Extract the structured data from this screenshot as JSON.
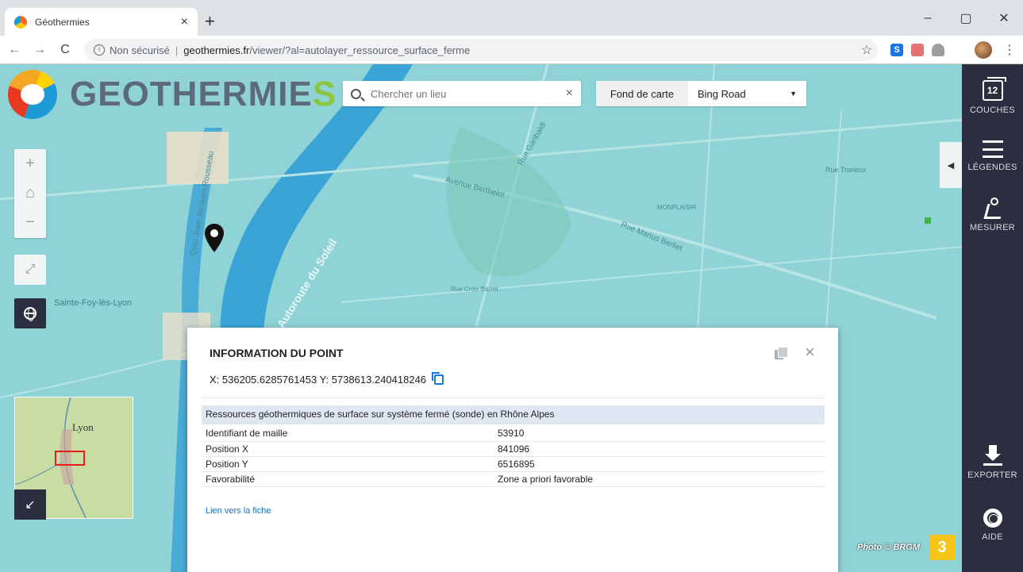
{
  "browser": {
    "tab_title": "Géothermies",
    "tab_close": "×",
    "new_tab": "+",
    "win_minimize": "–",
    "win_maximize": "▢",
    "win_close": "✕",
    "back": "←",
    "forward": "→",
    "reload": "C",
    "info_glyph": "i",
    "security_label": "Non sécurisé",
    "separator": "|",
    "url_domain": "geothermies.fr",
    "url_path": "/viewer/?al=autolayer_ressource_surface_ferme",
    "star": "☆",
    "ext1": "S",
    "menu": "⋮"
  },
  "app": {
    "logo_text_main": "GEOTHERMIE",
    "logo_text_last": "S",
    "search_placeholder": "Chercher un lieu",
    "search_clear": "×",
    "basemap_label": "Fond de carte",
    "basemap_value": "Bing Road",
    "basemap_caret": "▼",
    "zoom_in": "+",
    "home": "⌂",
    "zoom_out": "−",
    "fullscreen": "⤢",
    "overview_collapse": "↙",
    "overview_city": "Lyon",
    "side_collapse": "◀"
  },
  "map_labels": [
    {
      "text": "Autoroute du Soleil"
    },
    {
      "text": "Avenue Berthelot"
    },
    {
      "text": "Rue Marius Berliet"
    },
    {
      "text": "Sainte-Foy-lès-Lyon"
    },
    {
      "text": "Quai Jean-Jacques Rousseau"
    },
    {
      "text": "Rue Croix Barret"
    },
    {
      "text": "Rue Garibaldi"
    },
    {
      "text": "MONPLAISIR"
    },
    {
      "text": "Rue Trarieux"
    }
  ],
  "popup": {
    "title": "INFORMATION DU POINT",
    "coords": "X: 536205.6285761453 Y: 5738613.240418246",
    "close": "×",
    "layer_title": "Ressources géothermiques de surface sur système fermé (sonde) en Rhône Alpes",
    "rows": [
      {
        "key": "Identifiant de maille",
        "value": "53910"
      },
      {
        "key": "Position X",
        "value": "841096"
      },
      {
        "key": "Position Y",
        "value": "6516895"
      },
      {
        "key": "Favorabilité",
        "value": "Zone a priori favorable"
      }
    ],
    "link": "Lien vers la fiche"
  },
  "sidebar": {
    "layers_count": "12",
    "layers": "COUCHES",
    "legends": "LÉGENDES",
    "measure": "MESURER",
    "export": "EXPORTER",
    "help": "AIDE"
  },
  "overlay": {
    "credit": "Photo © BRGM",
    "badge": "3"
  },
  "colors": {
    "map_water": "#8fd3d6",
    "river": "#2c9bd6",
    "sidebar_bg": "#2b2e3f",
    "logo_green": "#8cc63f",
    "link": "#1a6fc4",
    "badge": "#f5c518"
  }
}
